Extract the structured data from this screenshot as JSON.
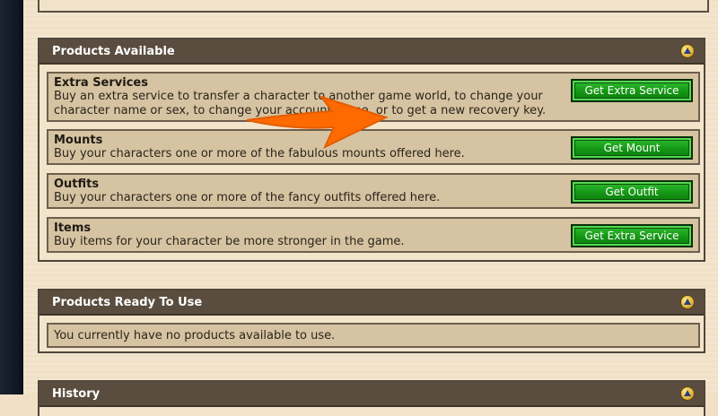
{
  "products_available": {
    "title": "Products Available",
    "items": [
      {
        "title": "Extra Services",
        "description": "Buy an extra service to transfer a character to another game world, to change your character name or sex, to change your account name, or to get a new recovery key.",
        "button": "Get Extra Service"
      },
      {
        "title": "Mounts",
        "description": "Buy your characters one or more of the fabulous mounts offered here.",
        "button": "Get Mount"
      },
      {
        "title": "Outfits",
        "description": "Buy your characters one or more of the fancy outfits offered here.",
        "button": "Get Outfit"
      },
      {
        "title": "Items",
        "description": "Buy items for your character be more stronger in the game.",
        "button": "Get Extra Service"
      }
    ]
  },
  "products_ready": {
    "title": "Products Ready To Use",
    "message": "You currently have no products available to use."
  },
  "history": {
    "title": "History"
  },
  "colors": {
    "panel_header": "#5a4d3f",
    "row_bg": "#d6c3a1",
    "button_green": "#159615",
    "arrow_orange": "#ff6a00"
  },
  "icons": [
    "collapse-icon",
    "arrow-annotation-icon"
  ]
}
